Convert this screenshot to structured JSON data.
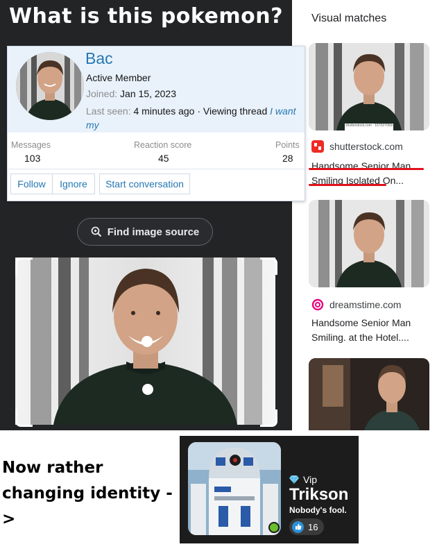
{
  "meme": {
    "title": "What is this pokemon?",
    "bottom_line1": "Now rather",
    "bottom_line2": "changing identity ->"
  },
  "profile": {
    "username": "Bac",
    "role": "Active Member",
    "joined_label": "Joined:",
    "joined_value": "Jan 15, 2023",
    "seen_label": "Last seen:",
    "seen_value": "4 minutes ago · Viewing thread",
    "seen_link": "I want my",
    "stats": [
      {
        "label": "Messages",
        "value": "103"
      },
      {
        "label": "Reaction score",
        "value": "45"
      },
      {
        "label": "Points",
        "value": "28"
      }
    ],
    "buttons": {
      "follow": "Follow",
      "ignore": "Ignore",
      "start": "Start conversation"
    }
  },
  "lens": {
    "find_source": "Find image source"
  },
  "visual_matches": {
    "heading": "Visual matches",
    "items": [
      {
        "source": "shutterstock.com",
        "title": "Handsome Senior Man Smiling Isolated On...",
        "icon_color": "#ee2b24",
        "icon": "shutterstock-icon"
      },
      {
        "source": "dreamstime.com",
        "title": "Handsome Senior Man Smiling. at the Hotel....",
        "icon_color": "#e5007d",
        "icon": "dreamstime-icon"
      }
    ],
    "watermark": "shutterstock.com · 1570270654"
  },
  "vip_card": {
    "badge": "Vip",
    "name": "Trikson",
    "tagline": "Nobody's fool.",
    "reactions": "16"
  },
  "colors": {
    "link_blue": "#2577b1",
    "dark_bg": "#232426",
    "red_underline": "#e0121b"
  }
}
